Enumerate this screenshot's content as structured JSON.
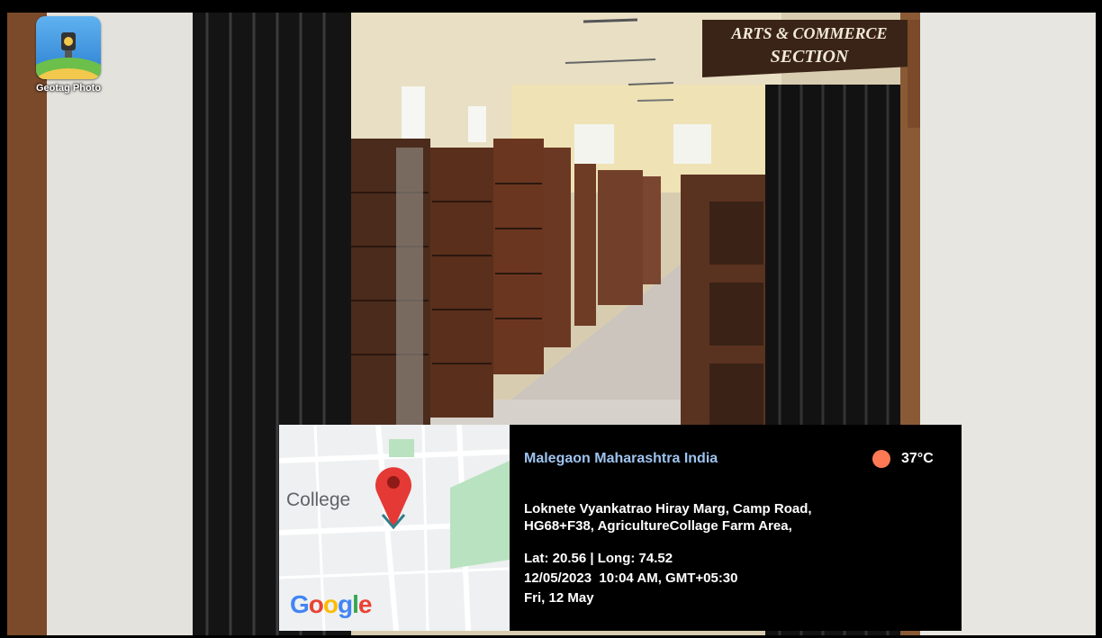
{
  "app": {
    "name": "Geotag Photo",
    "icon": "geotag-app-icon"
  },
  "photo": {
    "sign_line1": "ARTS & COMMERCE",
    "sign_line2": "SECTION"
  },
  "map": {
    "place_label": "College",
    "brand": [
      "G",
      "o",
      "o",
      "g",
      "l",
      "e"
    ],
    "brand_colors": [
      "#4285f4",
      "#ea4335",
      "#fbbc05",
      "#4285f4",
      "#34a853",
      "#ea4335"
    ],
    "pin_color": "#e53935"
  },
  "info": {
    "location_title": "Malegaon Maharashtra India",
    "temperature": "37°C",
    "weather_icon": "sun-icon",
    "address_line1": "Loknete Vyankatrao Hiray Marg, Camp Road,",
    "address_line2": "HG68+F38, AgricultureCollage Farm Area,",
    "coordinates": "Lat: 20.56 | Long: 74.52",
    "datetime": "12/05/2023  10:04 AM, GMT+05:30",
    "day": "Fri, 12 May"
  }
}
